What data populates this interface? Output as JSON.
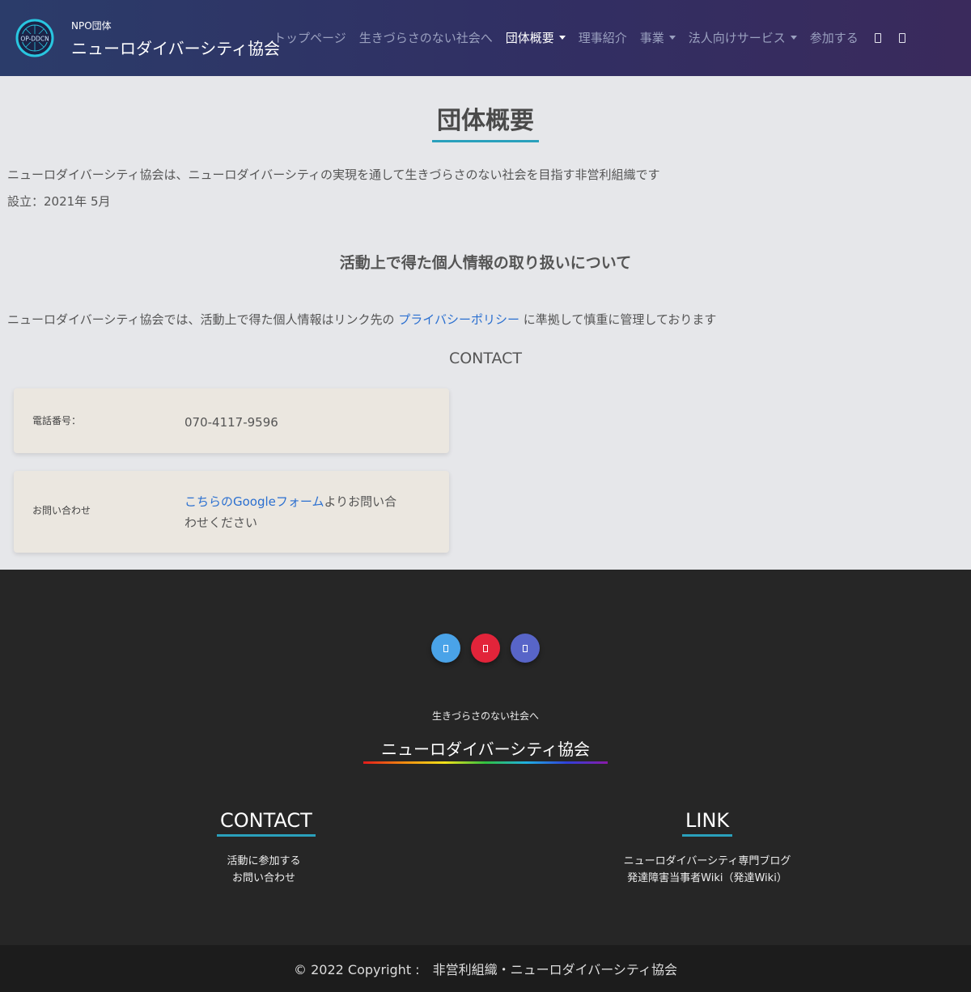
{
  "header": {
    "logo_text": "OP-DDCN",
    "brand_small": "NPO団体",
    "brand_name": "ニューロダイバーシティ協会",
    "nav": [
      {
        "label": "トップページ"
      },
      {
        "label": "生きづらさのない社会へ"
      },
      {
        "label": "団体概要",
        "dropdown": true,
        "active": true
      },
      {
        "label": "理事紹介"
      },
      {
        "label": "事業",
        "dropdown": true
      },
      {
        "label": "法人向けサービス",
        "dropdown": true
      },
      {
        "label": "参加する"
      }
    ],
    "nav_icons": [
      "book-icon",
      "document-icon"
    ]
  },
  "main": {
    "title": "団体概要",
    "intro": "ニューロダイバーシティ協会は、ニューロダイバーシティの実現を通して生きづらさのない社会を目指す非営利組織です",
    "established": "設立：2021年 5月",
    "privacy_heading": "活動上で得た個人情報の取り扱いについて",
    "privacy_text_before": "ニューロダイバーシティ協会では、活動上で得た個人情報はリンク先の",
    "privacy_link": "プライバシーポリシー",
    "privacy_text_after": "に準拠して慎重に管理しております",
    "contact_heading": "CONTACT",
    "phone_label": "電話番号：",
    "phone_value": "070-4117-9596",
    "inquiry_label": "お問い合わせ",
    "inquiry_link": "こちらのGoogleフォーム",
    "inquiry_text_1": "よりお問い合",
    "inquiry_text_2": "わせください"
  },
  "footer": {
    "social": [
      {
        "name": "twitter-icon",
        "color": "#4aa3e8"
      },
      {
        "name": "youtube-icon",
        "color": "#e2243a"
      },
      {
        "name": "discord-icon",
        "color": "#5865c8"
      }
    ],
    "tagline": "生きづらさのない社会へ",
    "org_name": "ニューロダイバーシティ協会",
    "contact_title": "CONTACT",
    "contact_links": [
      "活動に参加する",
      "お問い合わせ"
    ],
    "link_title": "LINK",
    "link_links": [
      "ニューロダイバーシティ専門ブログ",
      "発達障害当事者Wiki（発達Wiki）"
    ],
    "copyright": "© 2022 Copyright :　非営利組織・ニューロダイバーシティ協会"
  },
  "colors": {
    "accent": "#2aa0bc",
    "link": "#2a6fd0",
    "footer_bg": "#262626"
  }
}
